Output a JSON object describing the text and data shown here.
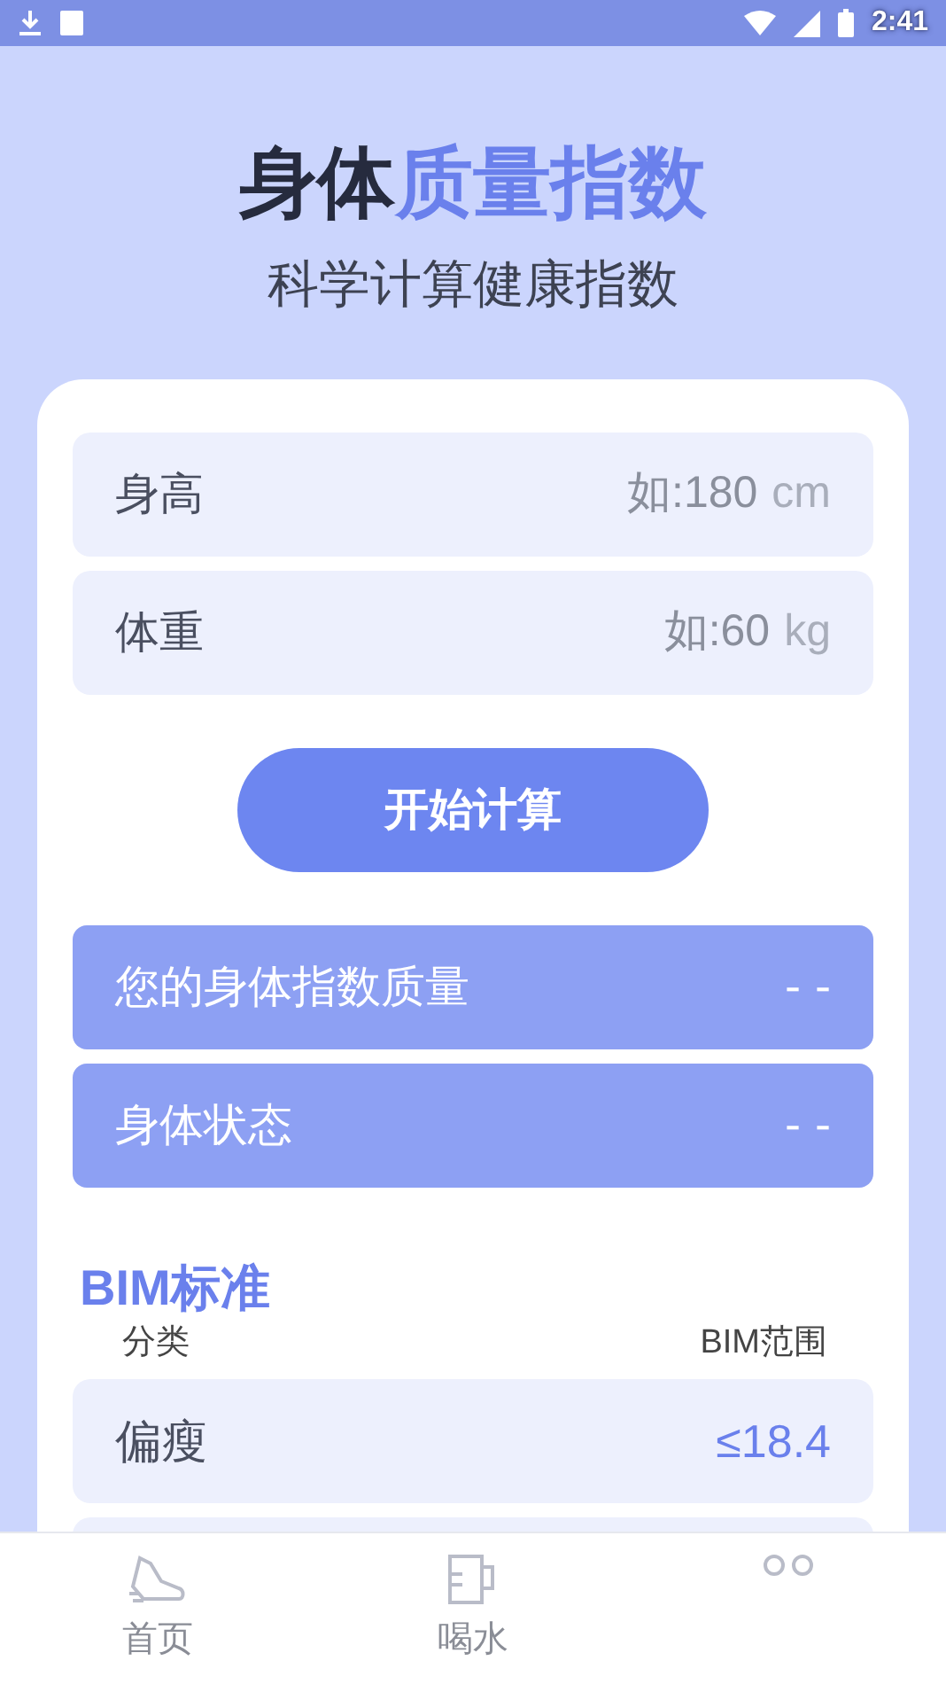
{
  "status_bar": {
    "time": "2:41"
  },
  "header": {
    "title_lead": "身体",
    "title_accent": "质量指数",
    "subtitle": "科学计算健康指数"
  },
  "inputs": [
    {
      "label": "身高",
      "placeholder": "如:180",
      "unit": "cm"
    },
    {
      "label": "体重",
      "placeholder": "如:60",
      "unit": "kg"
    }
  ],
  "calculate_button": "开始计算",
  "results": [
    {
      "label": "您的身体指数质量",
      "value": "- -"
    },
    {
      "label": "身体状态",
      "value": "- -"
    }
  ],
  "standard": {
    "title": "BIM标准",
    "columns": [
      "分类",
      "BIM范围"
    ],
    "rows": [
      {
        "category": "偏瘦",
        "range": "≤18.4"
      }
    ]
  },
  "bottom_nav": [
    {
      "kind": "shoe",
      "label": "首页"
    },
    {
      "kind": "cup",
      "label": "喝水"
    },
    {
      "kind": "face"
    }
  ]
}
